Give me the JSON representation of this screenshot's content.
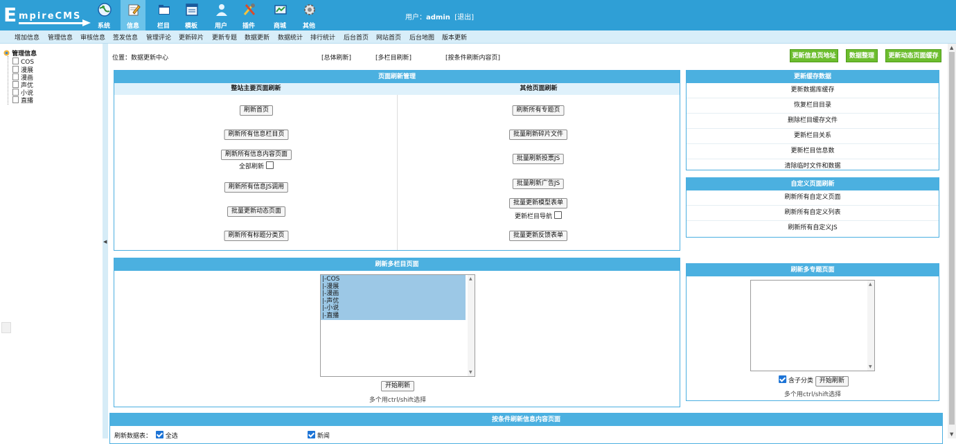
{
  "header": {
    "logo_text": "EmpireCMS",
    "nav": [
      {
        "label": "系统",
        "icon": "globe-icon",
        "active": false
      },
      {
        "label": "信息",
        "icon": "edit-icon",
        "active": true
      },
      {
        "label": "栏目",
        "icon": "folder-icon",
        "active": false
      },
      {
        "label": "模板",
        "icon": "template-icon",
        "active": false
      },
      {
        "label": "用户",
        "icon": "user-icon",
        "active": false
      },
      {
        "label": "插件",
        "icon": "tools-icon",
        "active": false
      },
      {
        "label": "商城",
        "icon": "shop-icon",
        "active": false
      },
      {
        "label": "其他",
        "icon": "gear-icon",
        "active": false
      }
    ],
    "user_label": "用户：",
    "user_name": "admin",
    "logout": "[退出]"
  },
  "submenu": [
    "增加信息",
    "管理信息",
    "审核信息",
    "签发信息",
    "管理评论",
    "更新碎片",
    "更新专题",
    "数据更新",
    "数据统计",
    "排行统计",
    "后台首页",
    "网站首页",
    "后台地图",
    "版本更新"
  ],
  "tree": {
    "root": "管理信息",
    "items": [
      "COS",
      "漫展",
      "漫画",
      "声优",
      "小说",
      "直播"
    ]
  },
  "location": {
    "label": "位置：",
    "path": "数据更新中心"
  },
  "toplinks": [
    "[总体刷新]",
    "[多栏目刷新]",
    "[按条件刷新内容页]"
  ],
  "action_buttons": [
    "更新信息页地址",
    "数据整理",
    "更新动态页面缓存"
  ],
  "page_refresh": {
    "title": "页面刷新管理",
    "left_header": "整站主要页面刷新",
    "right_header": "其他页面刷新",
    "left_buttons": [
      "刷新首页",
      "刷新所有信息栏目页",
      "刷新所有信息内容页面",
      "刷新所有信息JS调用",
      "批量更新动态页面",
      "刷新所有标题分类页"
    ],
    "full_refresh_label": "全部刷新",
    "right_buttons": [
      "刷新所有专题页",
      "批量刷新碎片文件",
      "批量刷新投票JS",
      "批量刷新广告JS",
      "批量更新模型表单",
      "批量更新反馈表单"
    ],
    "nav_label": "更新栏目导航"
  },
  "cache_panel": {
    "title": "更新缓存数据",
    "items": [
      "更新数据库缓存",
      "恢复栏目目录",
      "删除栏目缓存文件",
      "更新栏目关系",
      "更新栏目信息数",
      "清除临时文件和数据"
    ]
  },
  "custom_panel": {
    "title": "自定义页面刷新",
    "items": [
      "刷新所有自定义页面",
      "刷新所有自定义列表",
      "刷新所有自定义JS"
    ]
  },
  "multi_class": {
    "title": "刷新多栏目页面",
    "options": [
      "|-COS",
      "|-漫展",
      "|-漫画",
      "|-声优",
      "|-小说",
      "|-直播"
    ],
    "start": "开始刷新",
    "hint": "多个用ctrl/shift选择"
  },
  "multi_topic": {
    "title": "刷新多专题页面",
    "include_label": "含子分类",
    "start": "开始刷新",
    "hint": "多个用ctrl/shift选择"
  },
  "condition": {
    "title": "按条件刷新信息内容页面",
    "table_label": "刷新数据表：",
    "select_all": "全选",
    "news": "新闻"
  }
}
